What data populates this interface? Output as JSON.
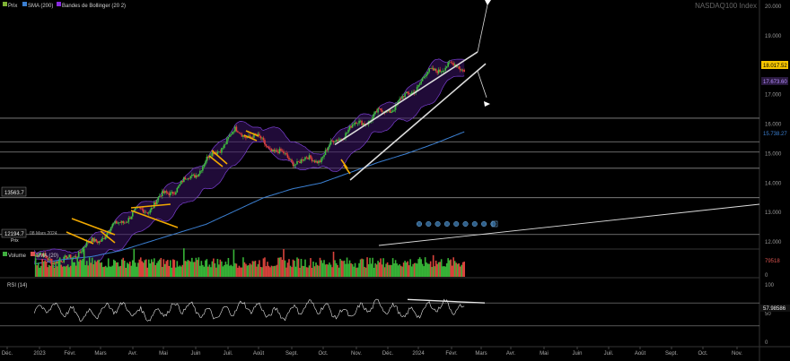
{
  "header": {
    "legend": [
      {
        "label": "Prix",
        "color": "#7fb236"
      },
      {
        "label": "SMA (200)",
        "color": "#3b7fd1"
      },
      {
        "label": "Bandes de Bollinger (20 2)",
        "color": "#8a2be2"
      }
    ],
    "symbol": "NASDAQ100 Index"
  },
  "price_axis": {
    "ticks": [
      "20.000",
      "19.000",
      "18.000",
      "17.000",
      "16.000",
      "15.000",
      "14.000",
      "13.000",
      "12.000"
    ],
    "last_price": "18.017.52",
    "sma_value": "15.738.27",
    "upper_band_value": "17.673.60"
  },
  "left_labels": {
    "level_1": "13563.7",
    "level_2": "12194.7",
    "date_hint": "08 Mars 2024",
    "tag": "Prix"
  },
  "volume_panel": {
    "legend": [
      {
        "label": "Volume",
        "color": "#3fae3f"
      },
      {
        "label": "SMA (20)",
        "color": "#d9534f"
      }
    ],
    "axis_value": "79518",
    "zero": "0"
  },
  "rsi_panel": {
    "title": "RSI (14)",
    "ticks": [
      "100",
      "50",
      "0"
    ],
    "value": "57.98586"
  },
  "x_axis": {
    "labels": [
      "Déc.",
      "2023",
      "Févr.",
      "Mars",
      "Avr.",
      "Mai",
      "Juin",
      "Juil.",
      "Août",
      "Sept.",
      "Oct.",
      "Nov.",
      "Déc.",
      "2024",
      "Févr.",
      "Mars",
      "Avr.",
      "Mai",
      "Juin",
      "Juil.",
      "Août",
      "Sept.",
      "Oct.",
      "Nov."
    ]
  },
  "chart_data": {
    "type": "line",
    "title": "NASDAQ100 Index",
    "xlabel": "",
    "ylabel": "",
    "ylim": [
      11200,
      20000
    ],
    "x": [
      "2022-12",
      "2023-01",
      "2023-02",
      "2023-03",
      "2023-04",
      "2023-05",
      "2023-06",
      "2023-07",
      "2023-08",
      "2023-09",
      "2023-10",
      "2023-11",
      "2023-12",
      "2024-01",
      "2024-02",
      "2024-03"
    ],
    "series": [
      {
        "name": "Prix",
        "values": [
          11500,
          11100,
          12100,
          12800,
          12950,
          13900,
          14900,
          15600,
          15300,
          14950,
          14800,
          15700,
          16500,
          17000,
          17700,
          18017
        ]
      },
      {
        "name": "SMA (200)",
        "values": [
          11250,
          11400,
          11500,
          11700,
          12000,
          12300,
          12600,
          13050,
          13500,
          13800,
          14000,
          14350,
          14700,
          15000,
          15350,
          15738
        ]
      },
      {
        "name": "Bandes de Bollinger (20 2)",
        "values": [
          12400,
          11900,
          12500,
          13300,
          13400,
          14600,
          15600,
          16000,
          15800,
          15500,
          15400,
          16100,
          16900,
          17400,
          18100,
          18600
        ]
      }
    ]
  }
}
